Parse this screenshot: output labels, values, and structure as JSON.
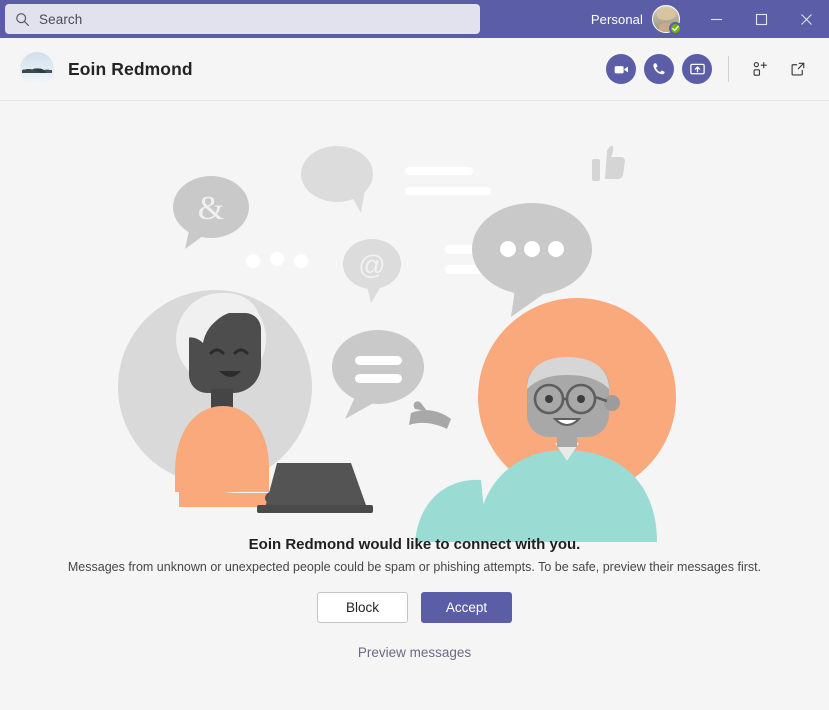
{
  "titlebar": {
    "search": {
      "placeholder": "Search",
      "value": "",
      "icon": "search-icon"
    },
    "account_label": "Personal",
    "presence": "available",
    "window_controls": {
      "minimize": "Minimize",
      "maximize": "Maximize",
      "close": "Close"
    },
    "accent_color": "#5b5ea6",
    "search_bg": "#e2e2ee",
    "presence_color": "#6bb700"
  },
  "chat_header": {
    "peer_name": "Eoin Redmond",
    "actions": [
      {
        "name": "video-call-icon",
        "label": "Video call"
      },
      {
        "name": "audio-call-icon",
        "label": "Audio call"
      },
      {
        "name": "screen-share-icon",
        "label": "Share screen"
      },
      {
        "name": "add-people-icon",
        "label": "Add people"
      },
      {
        "name": "pop-out-icon",
        "label": "Pop out chat"
      }
    ]
  },
  "main": {
    "illustration": "two-people-chatting-illustration",
    "bubble_symbols": [
      "&",
      "@",
      "=",
      "..."
    ],
    "title": "Eoin Redmond would like to connect with you.",
    "subtitle": "Messages from unknown or unexpected people could be spam or phishing attempts. To be safe, preview their messages first.",
    "block_label": "Block",
    "accept_label": "Accept",
    "preview_label": "Preview messages",
    "accent_color": "#5b5ea6",
    "illustration_colors": {
      "gray": "#d3d3d3",
      "light_gray": "#dcdcdc",
      "peach": "#f9a97b",
      "teal": "#9adbd3",
      "dark": "#4a4a4a"
    }
  }
}
